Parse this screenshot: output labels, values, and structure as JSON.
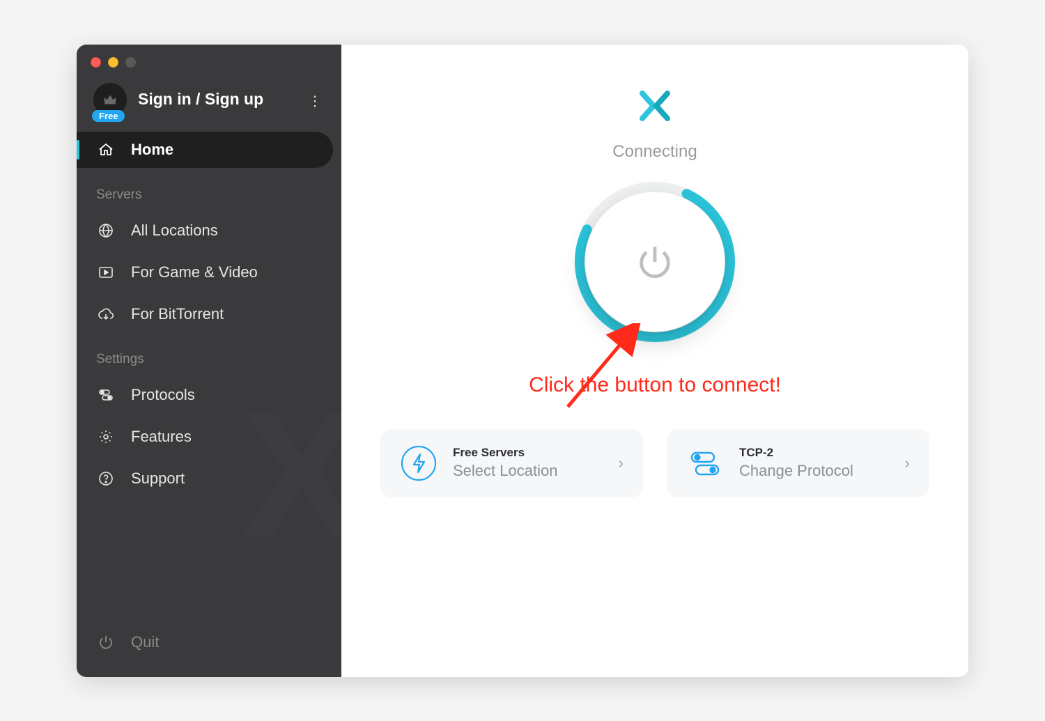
{
  "sidebar": {
    "account": {
      "sign_in_label": "Sign in / Sign up",
      "badge_text": "Free"
    },
    "nav": {
      "home_label": "Home",
      "servers_heading": "Servers",
      "all_locations_label": "All Locations",
      "game_video_label": "For Game & Video",
      "bittorrent_label": "For BitTorrent",
      "settings_heading": "Settings",
      "protocols_label": "Protocols",
      "features_label": "Features",
      "support_label": "Support",
      "quit_label": "Quit"
    }
  },
  "main": {
    "status_text": "Connecting",
    "annotation_text": "Click the button to connect!",
    "cards": {
      "location": {
        "title": "Free Servers",
        "subtitle": "Select Location"
      },
      "protocol": {
        "title": "TCP-2",
        "subtitle": "Change Protocol"
      }
    }
  },
  "colors": {
    "accent_teal": "#2cc5db",
    "accent_blue": "#23a6f2",
    "anno_red": "#ff2a1a"
  }
}
